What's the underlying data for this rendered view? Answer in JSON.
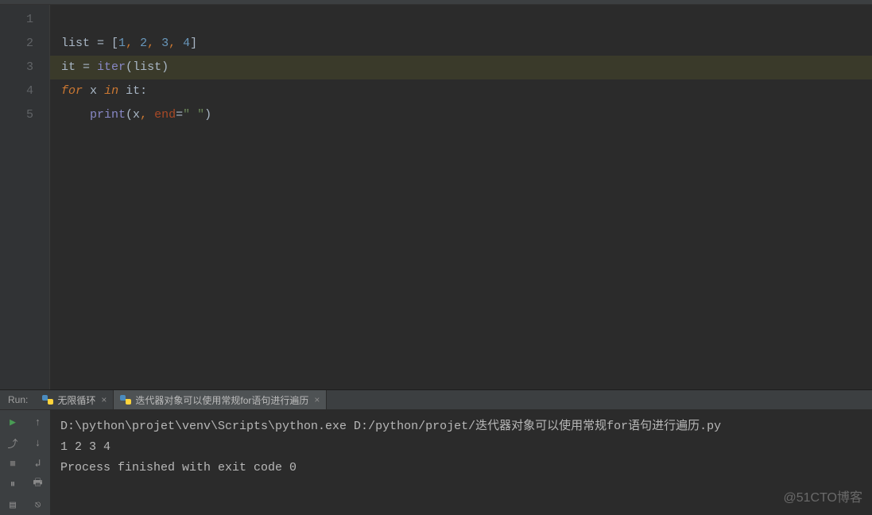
{
  "editor": {
    "line_numbers": [
      "1",
      "2",
      "3",
      "4",
      "5"
    ],
    "current_line": 3,
    "lines": {
      "l2": {
        "ident": "list",
        "eq": " = ",
        "lb": "[",
        "n1": "1",
        "c": ", ",
        "n2": "2",
        "n3": "3",
        "n4": "4",
        "rb": "]"
      },
      "l3": {
        "ident": "it",
        "eq": " = ",
        "fn": "iter",
        "lp": "(",
        "arg": "list",
        "rp": ")"
      },
      "l4": {
        "for": "for",
        "sp1": " ",
        "x": "x",
        "sp2": " ",
        "in": "in",
        "sp3": " ",
        "it": "it",
        "colon": ":"
      },
      "l5": {
        "indent": "    ",
        "fn": "print",
        "lp": "(",
        "x": "x",
        "c": ", ",
        "kw": "end",
        "eq": "=",
        "s": "\" \"",
        "rp": ")"
      }
    }
  },
  "run": {
    "label": "Run:",
    "tabs": [
      {
        "label": "无限循环",
        "active": false
      },
      {
        "label": "迭代器对象可以使用常规for语句进行遍历",
        "active": true
      }
    ]
  },
  "console": {
    "cmd": "D:\\python\\projet\\venv\\Scripts\\python.exe D:/python/projet/迭代器对象可以使用常规for语句进行遍历.py",
    "output": "1 2 3 4",
    "exit": "Process finished with exit code 0"
  },
  "watermark": "@51CTO博客"
}
